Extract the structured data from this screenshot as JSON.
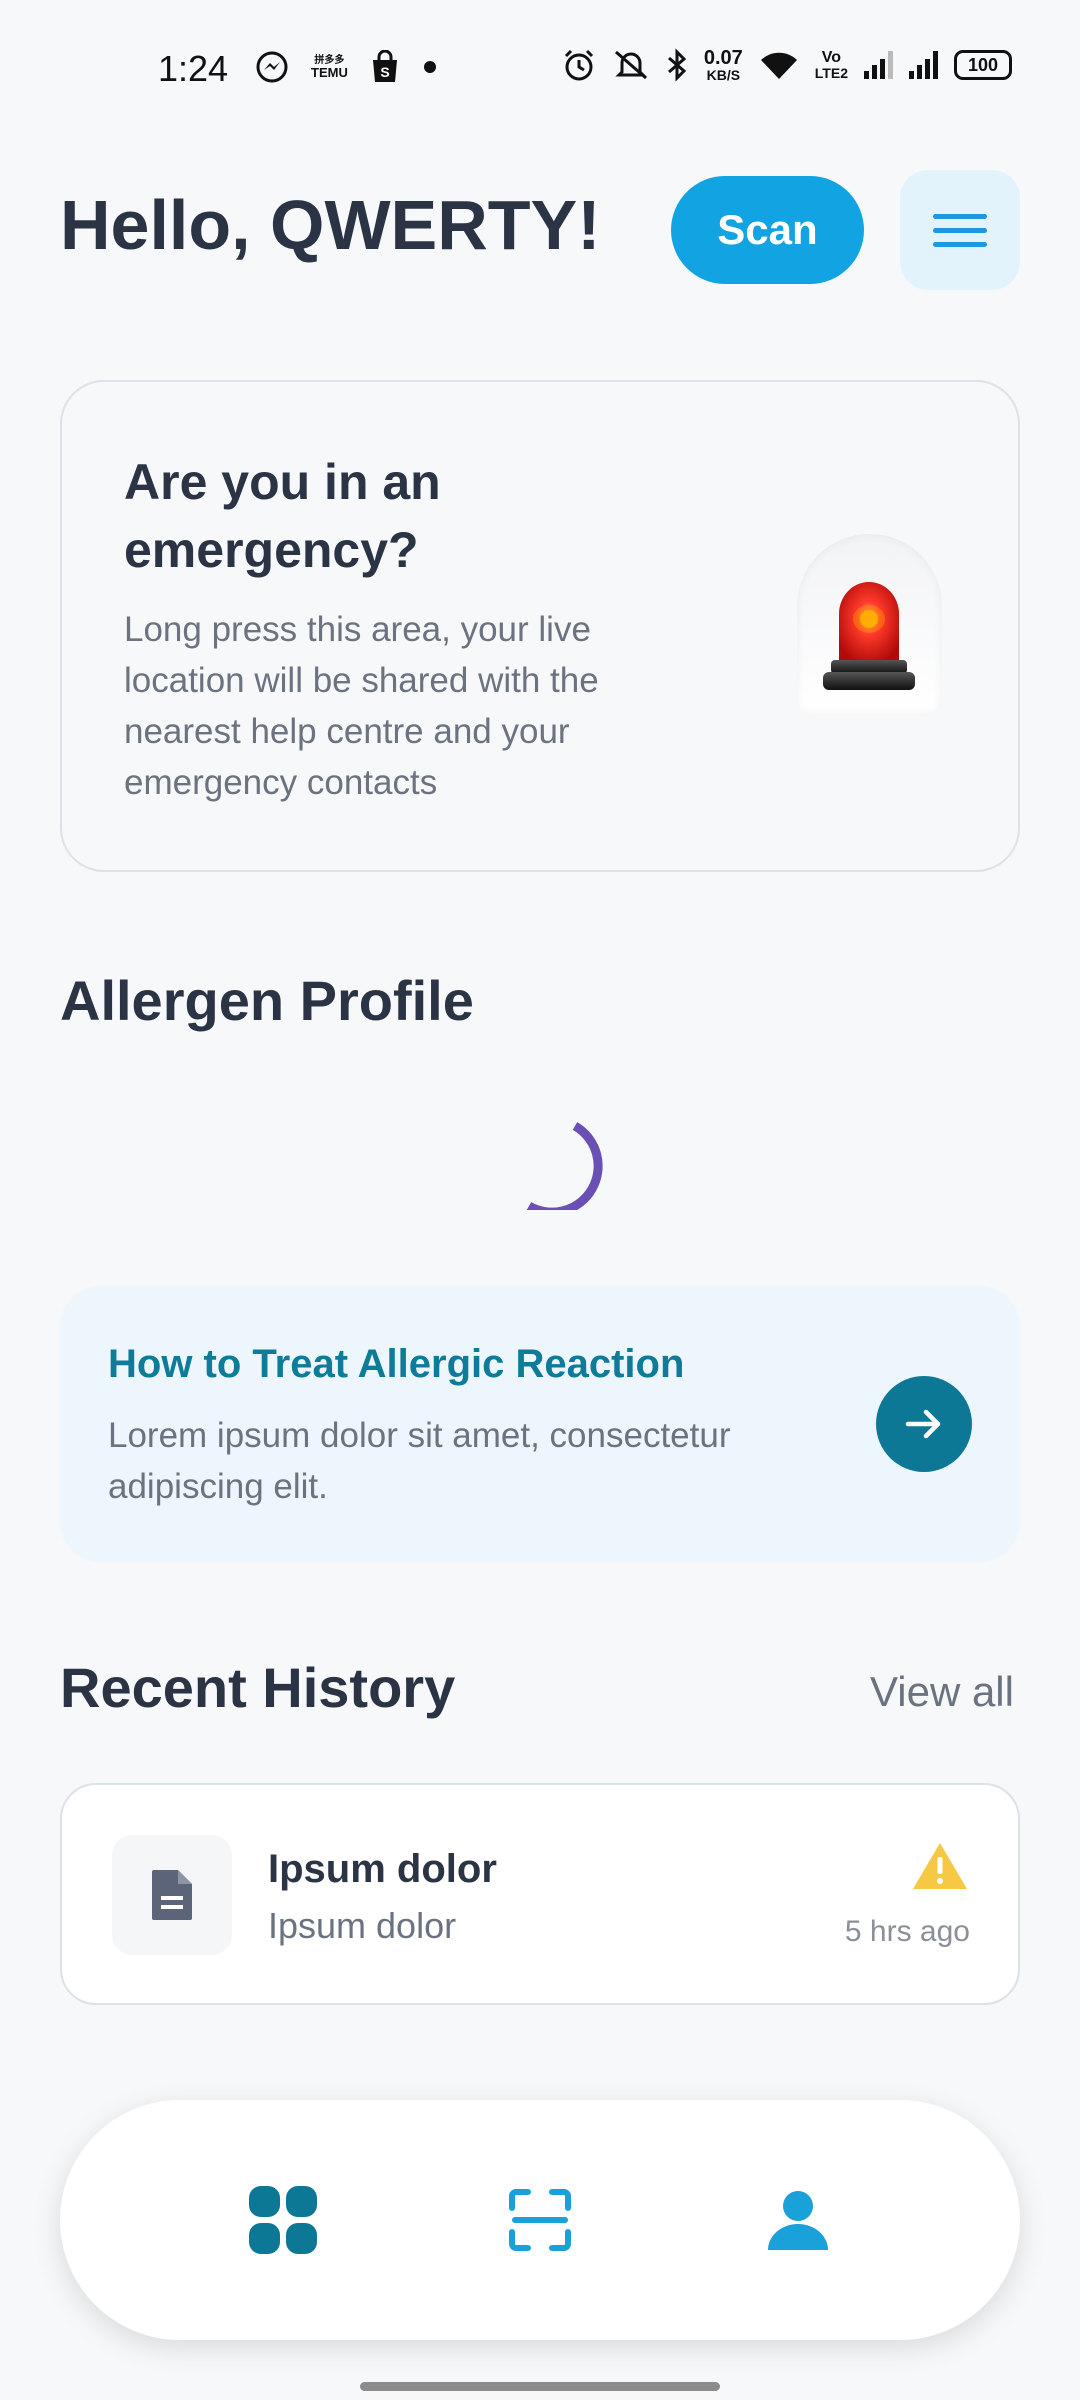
{
  "status_bar": {
    "time": "1:24",
    "net_speed_value": "0.07",
    "net_speed_unit": "KB/S",
    "volte_top": "Vo",
    "volte_bottom": "LTE2",
    "battery": "100",
    "temu_top": "拼多多",
    "temu_bottom": "TEMU"
  },
  "header": {
    "greeting": "Hello, QWERTY!",
    "scan_label": "Scan"
  },
  "emergency": {
    "title": "Are you in an emergency?",
    "description": "Long press this area, your live location will be shared with the nearest help centre and your emergency contacts"
  },
  "allergen_profile": {
    "title": "Allergen Profile"
  },
  "howto": {
    "title": "How to Treat Allergic Reaction",
    "description": "Lorem ipsum dolor sit amet, consectetur adipiscing elit."
  },
  "recent_history": {
    "title": "Recent History",
    "view_all": "View all",
    "items": [
      {
        "title": "Ipsum dolor",
        "subtitle": "Ipsum dolor",
        "time": "5 hrs ago",
        "icon": "warning-icon"
      }
    ]
  },
  "bottom_nav": {
    "items": [
      {
        "icon": "dashboard-icon"
      },
      {
        "icon": "scan-icon"
      },
      {
        "icon": "profile-icon"
      }
    ]
  },
  "colors": {
    "accent": "#12a3e3",
    "teal": "#0d7896",
    "warning": "#f7c843",
    "loader": "#6a4fb5"
  }
}
